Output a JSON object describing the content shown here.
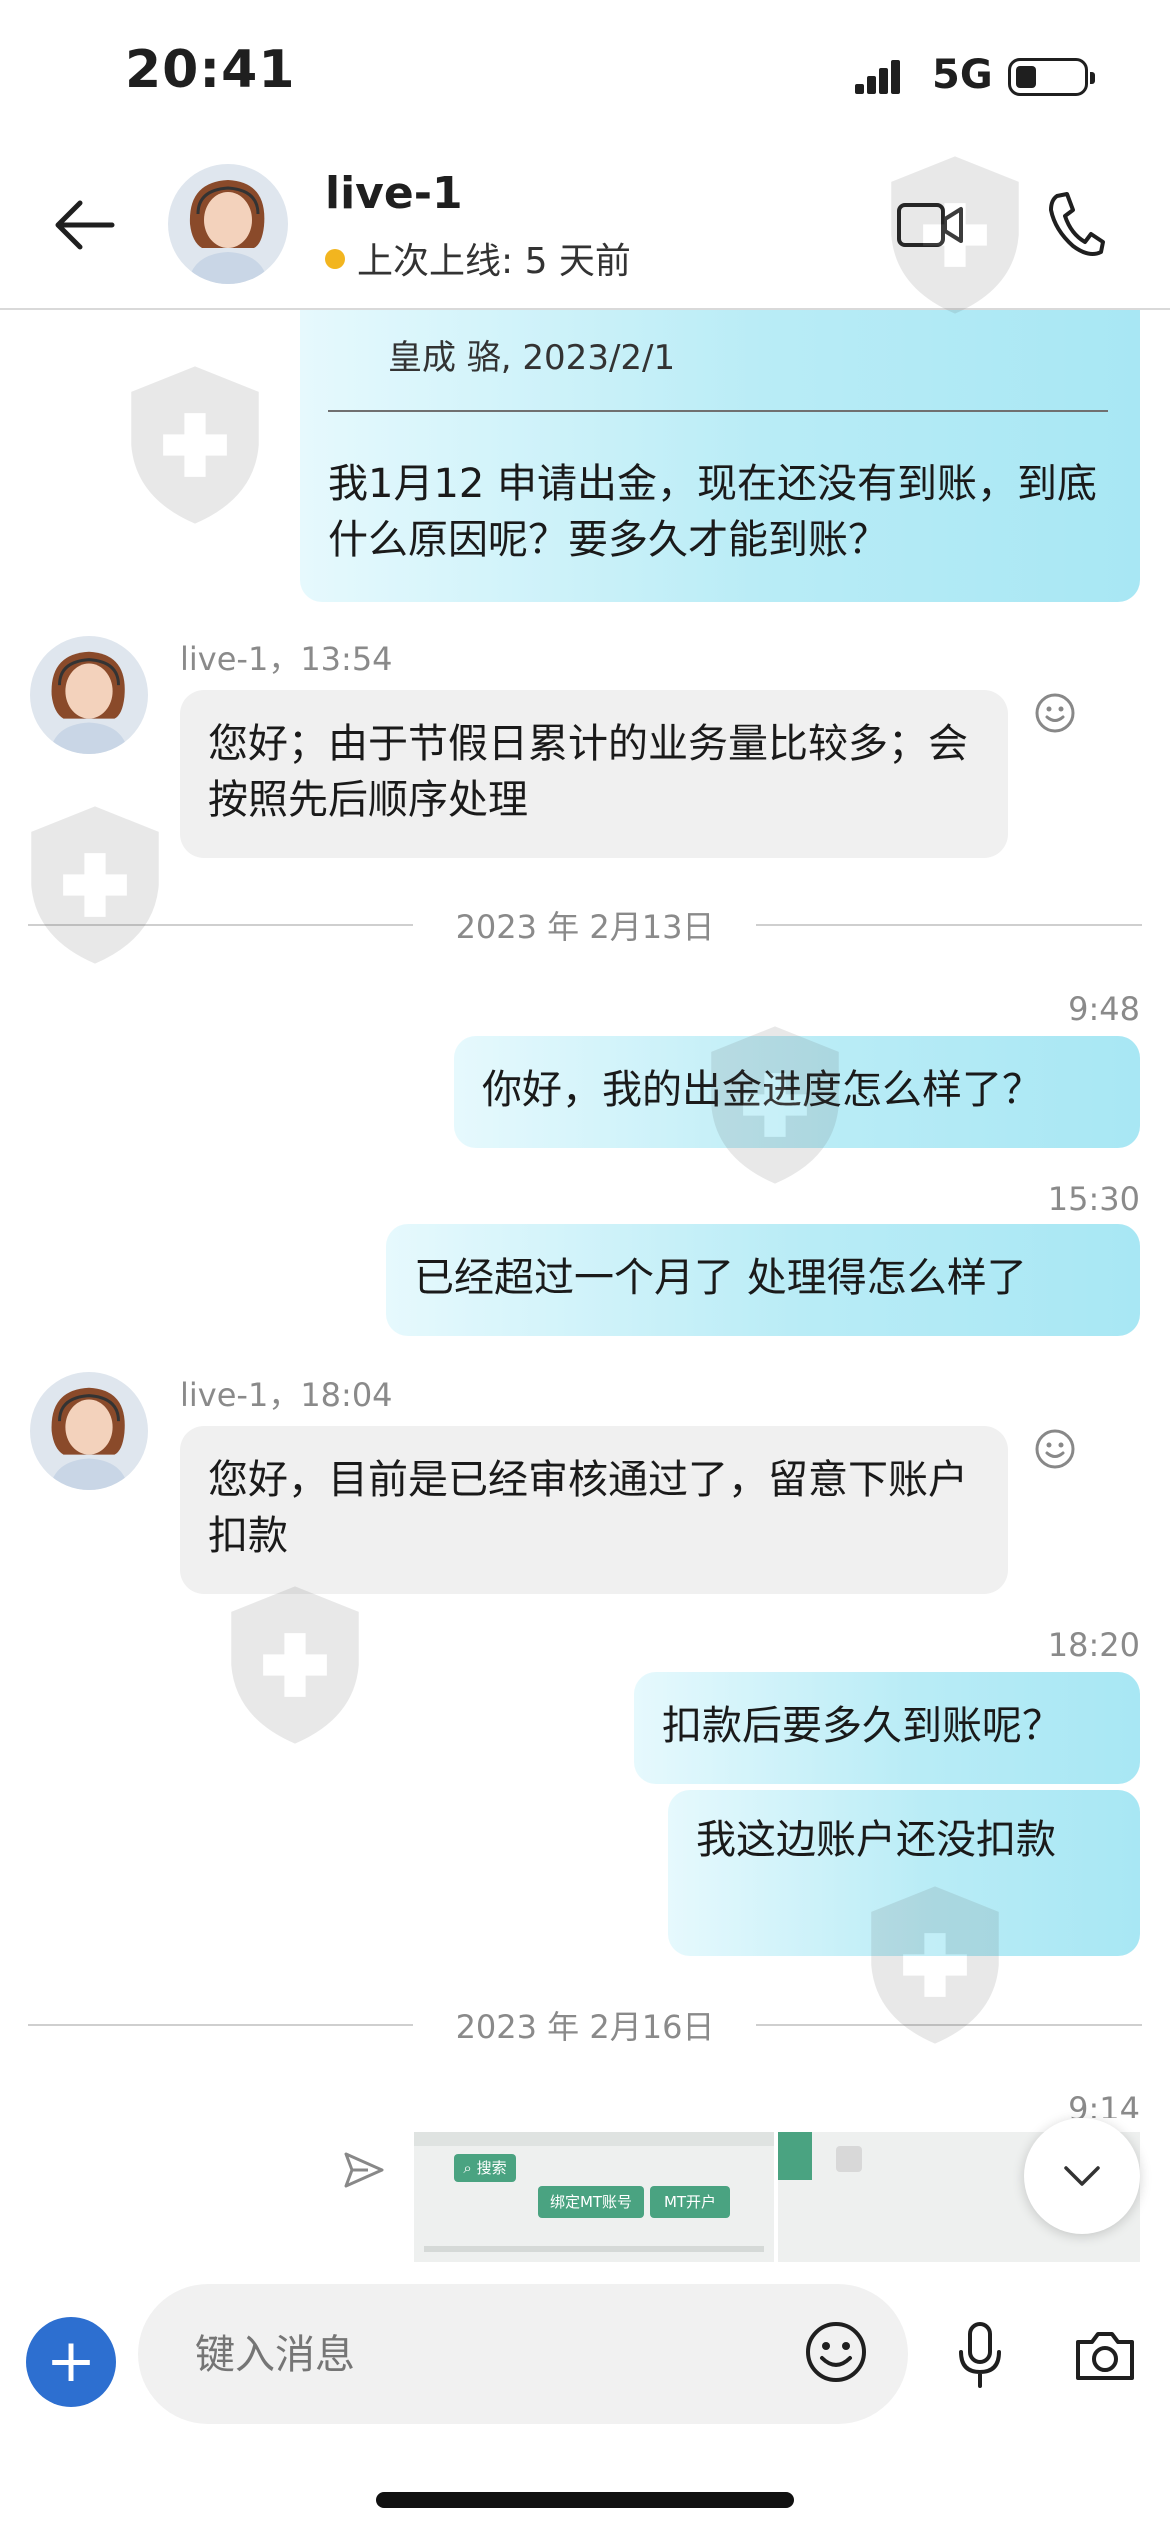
{
  "status_bar": {
    "time": "20:41",
    "network": "5G"
  },
  "header": {
    "contact_name": "live-1",
    "presence": "上次上线: 5 天前"
  },
  "messages": {
    "quoted_author": "皇成 骆, 2023/2/1",
    "m1_text": "我1月12 申请出金，现在还没有到账，到底什么原因呢？要多久才能到账？",
    "r1_meta": "live-1，13:54",
    "r1_text": "您好；由于节假日累计的业务量比较多；会按照先后顺序处理",
    "sep1": "2023 年 2月13日",
    "t1": "9:48",
    "m2_text": "你好，我的出金进度怎么样了？",
    "t2": "15:30",
    "m3_text": "已经超过一个月了 处理得怎么样了",
    "r2_meta": "live-1，18:04",
    "r2_text": "您好，目前是已经审核通过了，留意下账户扣款",
    "t3": "18:20",
    "m4_text": "扣款后要多久到账呢？",
    "m5_text": "我这边账户还没扣款",
    "sep2": "2023 年 2月16日",
    "t4": "9:14",
    "attachment_btn1": "搜索",
    "attachment_btn2": "绑定MT账号",
    "attachment_btn3": "MT开户"
  },
  "composer": {
    "placeholder": "键入消息"
  },
  "colors": {
    "accent": "#2d6fd0",
    "outgoing": "#a8e7f4",
    "incoming": "#f0f0f0",
    "presence": "#f2b51f"
  }
}
